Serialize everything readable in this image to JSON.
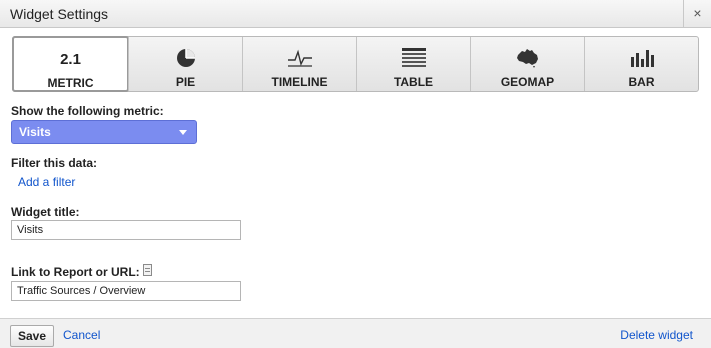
{
  "dialog": {
    "title": "Widget Settings",
    "close_glyph": "×"
  },
  "viz_tabs": [
    {
      "id": "metric",
      "label": "METRIC",
      "icon_text": "2.1",
      "active": true
    },
    {
      "id": "pie",
      "label": "PIE",
      "icon": "pie-chart-icon"
    },
    {
      "id": "timeline",
      "label": "TIMELINE",
      "icon": "timeline-icon"
    },
    {
      "id": "table",
      "label": "TABLE",
      "icon": "table-icon"
    },
    {
      "id": "geomap",
      "label": "GEOMAP",
      "icon": "map-icon"
    },
    {
      "id": "bar",
      "label": "BAR",
      "icon": "bar-chart-icon"
    }
  ],
  "metric": {
    "label": "Show the following metric:",
    "selected": "Visits"
  },
  "filter": {
    "label": "Filter this data:",
    "add_link": "Add a filter"
  },
  "widget_title": {
    "label": "Widget title:",
    "value": "Visits"
  },
  "link_to": {
    "label": "Link to Report or URL:",
    "value": "Traffic Sources / Overview"
  },
  "footer": {
    "save": "Save",
    "cancel": "Cancel",
    "delete": "Delete widget"
  },
  "colors": {
    "select_bg": "#7b8cf0",
    "link": "#1155cc"
  }
}
